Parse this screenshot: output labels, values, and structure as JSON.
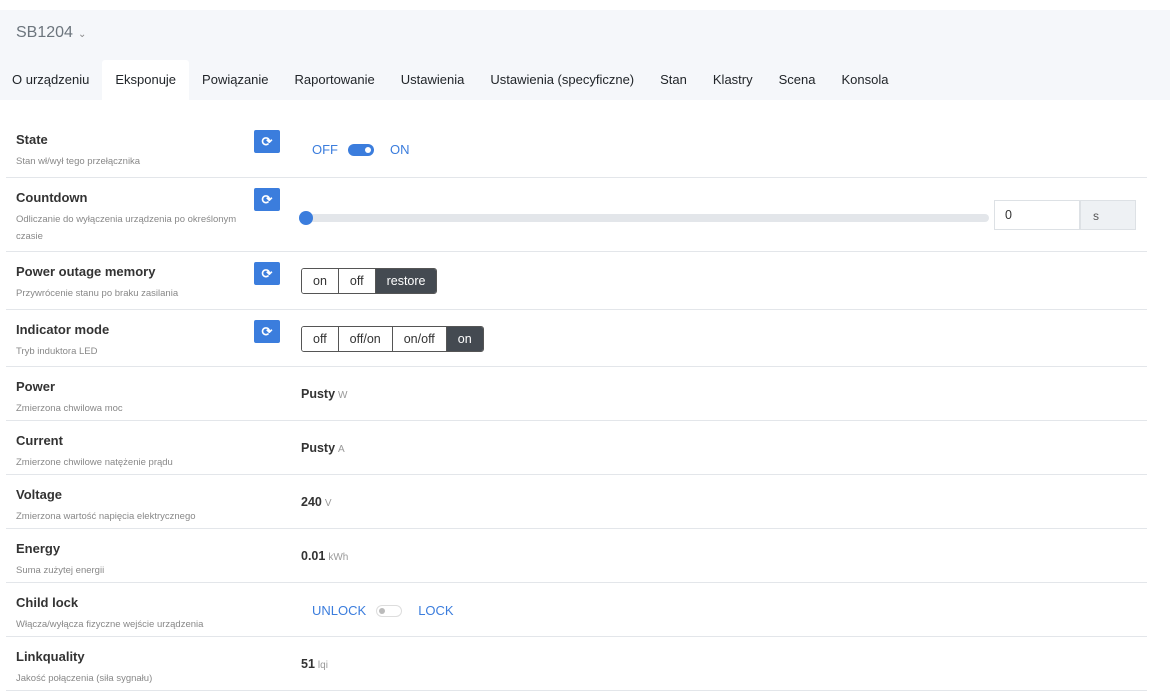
{
  "device": {
    "name": "SB1204"
  },
  "tabs": [
    "O urządzeniu",
    "Eksponuje",
    "Powiązanie",
    "Raportowanie",
    "Ustawienia",
    "Ustawienia (specyficzne)",
    "Stan",
    "Klastry",
    "Scena",
    "Konsola"
  ],
  "active_tab": "Eksponuje",
  "rows": {
    "state": {
      "title": "State",
      "desc": "Stan wł/wył tego przełącznika",
      "off": "OFF",
      "on": "ON",
      "value": "ON"
    },
    "countdown": {
      "title": "Countdown",
      "desc": "Odliczanie do wyłączenia urządzenia po określonym czasie",
      "value": "0",
      "unit": "s",
      "slider_fraction": 0
    },
    "pom": {
      "title": "Power outage memory",
      "desc": "Przywrócenie stanu po braku zasilania",
      "options": [
        "on",
        "off",
        "restore"
      ],
      "selected": "restore"
    },
    "indicator": {
      "title": "Indicator mode",
      "desc": "Tryb induktora LED",
      "options": [
        "off",
        "off/on",
        "on/off",
        "on"
      ],
      "selected": "on"
    },
    "power": {
      "title": "Power",
      "desc": "Zmierzona chwilowa moc",
      "value": "Pusty",
      "unit": "W"
    },
    "current": {
      "title": "Current",
      "desc": "Zmierzone chwilowe natężenie prądu",
      "value": "Pusty",
      "unit": "A"
    },
    "voltage": {
      "title": "Voltage",
      "desc": "Zmierzona wartość napięcia elektrycznego",
      "value": "240",
      "unit": "V"
    },
    "energy": {
      "title": "Energy",
      "desc": "Suma zużytej energii",
      "value": "0.01",
      "unit": "kWh"
    },
    "childlock": {
      "title": "Child lock",
      "desc": "Włącza/wyłącza fizyczne wejście urządzenia",
      "off": "UNLOCK",
      "on": "LOCK",
      "value": "UNLOCK"
    },
    "lqi": {
      "title": "Linkquality",
      "desc": "Jakość połączenia (siła sygnału)",
      "value": "51",
      "unit": "lqi"
    }
  }
}
